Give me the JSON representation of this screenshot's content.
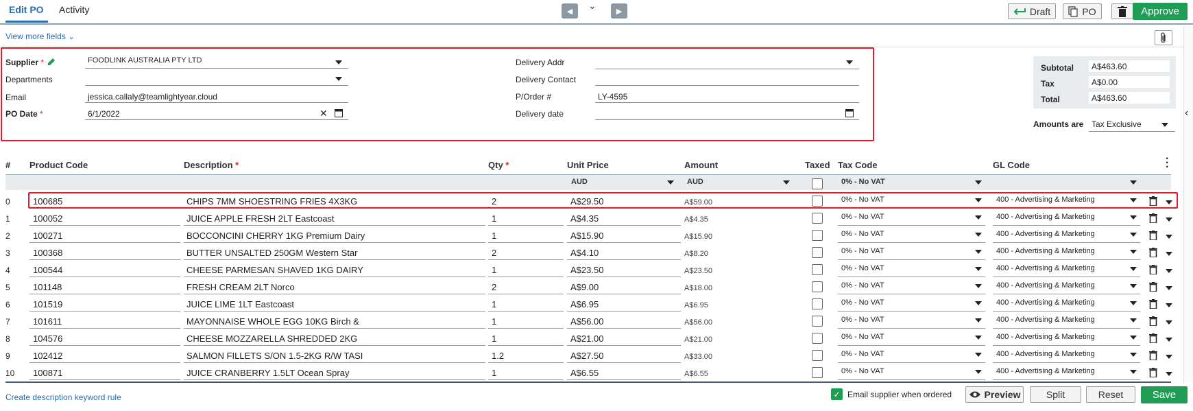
{
  "tabs": {
    "edit_po": "Edit PO",
    "activity": "Activity"
  },
  "toolbar": {
    "draft": "Draft",
    "po": "PO",
    "approve": "Approve"
  },
  "view_more_fields": "View more fields",
  "form": {
    "supplier_label": "Supplier",
    "supplier_value": "FOODLINK AUSTRALIA PTY LTD",
    "departments_label": "Departments",
    "email_label": "Email",
    "email_value": "jessica.callaly@teamlightyear.cloud",
    "po_date_label": "PO Date",
    "po_date_value": "6/1/2022",
    "delivery_addr_label": "Delivery Addr",
    "delivery_contact_label": "Delivery Contact",
    "porder_label": "P/Order #",
    "porder_value": "LY-4595",
    "delivery_date_label": "Delivery date",
    "required_mark": "*"
  },
  "totals": {
    "subtotal_label": "Subtotal",
    "subtotal": "A$463.60",
    "tax_label": "Tax",
    "tax": "A$0.00",
    "total_label": "Total",
    "total": "A$463.60",
    "amounts_are_label": "Amounts are",
    "amounts_are": "Tax Exclusive"
  },
  "table": {
    "headers": {
      "num": "#",
      "product_code": "Product Code",
      "description": "Description",
      "qty": "Qty",
      "unit_price": "Unit Price",
      "amount": "Amount",
      "taxed": "Taxed",
      "tax_code": "Tax Code",
      "gl_code": "GL Code"
    },
    "sub": {
      "unit_currency": "AUD",
      "amount_currency": "AUD",
      "tax_code": "0% - No VAT"
    },
    "rows": [
      {
        "n": "0",
        "code": "100685",
        "desc": "CHIPS 7MM SHOESTRING FRIES 4X3KG",
        "qty": "2",
        "price": "A$29.50",
        "amount": "A$59.00",
        "tax": "0% - No VAT",
        "gl": "400 - Advertising & Marketing"
      },
      {
        "n": "1",
        "code": "100052",
        "desc": "JUICE APPLE FRESH 2LT Eastcoast",
        "qty": "1",
        "price": "A$4.35",
        "amount": "A$4.35",
        "tax": "0% - No VAT",
        "gl": "400 - Advertising & Marketing"
      },
      {
        "n": "2",
        "code": "100271",
        "desc": "BOCCONCINI CHERRY 1KG Premium Dairy",
        "qty": "1",
        "price": "A$15.90",
        "amount": "A$15.90",
        "tax": "0% - No VAT",
        "gl": "400 - Advertising & Marketing"
      },
      {
        "n": "3",
        "code": "100368",
        "desc": "BUTTER UNSALTED 250GM Western Star",
        "qty": "2",
        "price": "A$4.10",
        "amount": "A$8.20",
        "tax": "0% - No VAT",
        "gl": "400 - Advertising & Marketing"
      },
      {
        "n": "4",
        "code": "100544",
        "desc": "CHEESE PARMESAN SHAVED 1KG DAIRY",
        "qty": "1",
        "price": "A$23.50",
        "amount": "A$23.50",
        "tax": "0% - No VAT",
        "gl": "400 - Advertising & Marketing"
      },
      {
        "n": "5",
        "code": "101148",
        "desc": "FRESH CREAM 2LT Norco",
        "qty": "2",
        "price": "A$9.00",
        "amount": "A$18.00",
        "tax": "0% - No VAT",
        "gl": "400 - Advertising & Marketing"
      },
      {
        "n": "6",
        "code": "101519",
        "desc": "JUICE LIME 1LT Eastcoast",
        "qty": "1",
        "price": "A$6.95",
        "amount": "A$6.95",
        "tax": "0% - No VAT",
        "gl": "400 - Advertising & Marketing"
      },
      {
        "n": "7",
        "code": "101611",
        "desc": "MAYONNAISE WHOLE EGG 10KG Birch &",
        "qty": "1",
        "price": "A$56.00",
        "amount": "A$56.00",
        "tax": "0% - No VAT",
        "gl": "400 - Advertising & Marketing"
      },
      {
        "n": "8",
        "code": "104576",
        "desc": "CHEESE MOZZARELLA SHREDDED 2KG",
        "qty": "1",
        "price": "A$21.00",
        "amount": "A$21.00",
        "tax": "0% - No VAT",
        "gl": "400 - Advertising & Marketing"
      },
      {
        "n": "9",
        "code": "102412",
        "desc": "SALMON FILLETS S/ON 1.5-2KG R/W TASI",
        "qty": "1.2",
        "price": "A$27.50",
        "amount": "A$33.00",
        "tax": "0% - No VAT",
        "gl": "400 - Advertising & Marketing"
      },
      {
        "n": "10",
        "code": "100871",
        "desc": "JUICE CRANBERRY 1.5LT Ocean Spray",
        "qty": "1",
        "price": "A$6.55",
        "amount": "A$6.55",
        "tax": "0% - No VAT",
        "gl": "400 - Advertising & Marketing"
      }
    ]
  },
  "footer": {
    "keyword_rule": "Create description keyword rule",
    "email_supplier": "Email supplier when ordered",
    "preview": "Preview",
    "split": "Split",
    "reset": "Reset",
    "save": "Save"
  },
  "colors": {
    "accent": "#2b6cb0",
    "green": "#1f9d55",
    "highlight": "#e01e2a"
  }
}
